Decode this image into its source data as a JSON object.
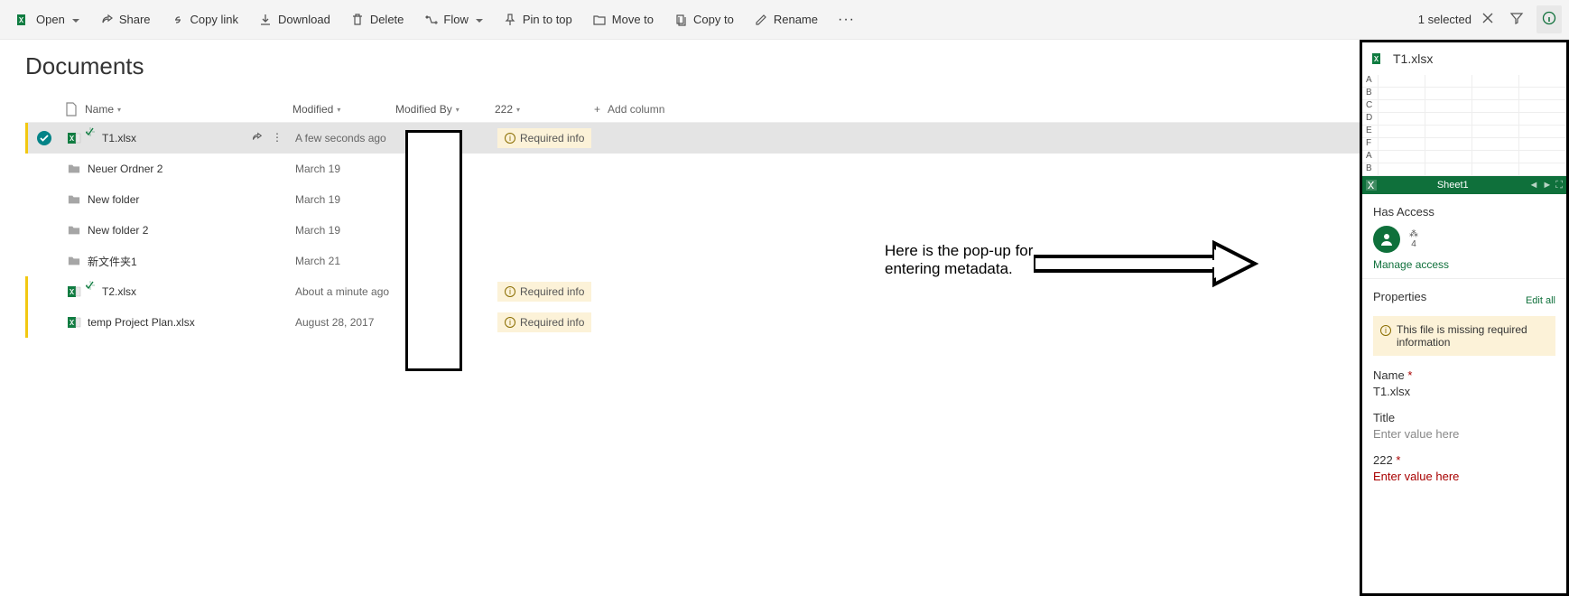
{
  "toolbar": {
    "open": "Open",
    "share": "Share",
    "copy_link": "Copy link",
    "download": "Download",
    "delete": "Delete",
    "flow": "Flow",
    "pin": "Pin to top",
    "move": "Move to",
    "copy_to": "Copy to",
    "rename": "Rename",
    "selected": "1 selected"
  },
  "page_title": "Documents",
  "columns": {
    "name": "Name",
    "modified": "Modified",
    "modified_by": "Modified By",
    "c222": "222",
    "add": "Add column"
  },
  "required_info": "Required info",
  "rows": [
    {
      "type": "file",
      "icon": "excel",
      "name": "T1.xlsx",
      "modified": "A few seconds ago",
      "attn": true,
      "selected": true,
      "req": true,
      "new": true
    },
    {
      "type": "folder",
      "name": "Neuer Ordner 2",
      "modified": "March 19"
    },
    {
      "type": "folder",
      "name": "New folder",
      "modified": "March 19"
    },
    {
      "type": "folder",
      "name": "New folder 2",
      "modified": "March 19"
    },
    {
      "type": "folder",
      "name": "新文件夹1",
      "modified": "March 21"
    },
    {
      "type": "file",
      "icon": "excel",
      "name": "T2.xlsx",
      "modified": "About a minute ago",
      "attn": true,
      "req": true,
      "new": true
    },
    {
      "type": "file",
      "icon": "excel",
      "name": "temp Project Plan.xlsx",
      "modified": "August 28, 2017",
      "attn": true,
      "req": true
    }
  ],
  "annotation": {
    "text_l1": "Here is the pop-up for",
    "text_l2": "entering metadata."
  },
  "panel": {
    "filename": "T1.xlsx",
    "sheet_rows": [
      "A",
      "B",
      "C",
      "D",
      "E",
      "F",
      "A",
      "B"
    ],
    "sheet_tab": "Sheet1",
    "has_access": "Has Access",
    "more_users": "4",
    "manage_access": "Manage access",
    "properties": "Properties",
    "edit_all": "Edit all",
    "missing_info": "This file is missing required information",
    "fields": {
      "name_label": "Name",
      "name_value": "T1.xlsx",
      "title_label": "Title",
      "title_ph": "Enter value here",
      "f222_label": "222",
      "f222_ph": "Enter value here"
    }
  }
}
